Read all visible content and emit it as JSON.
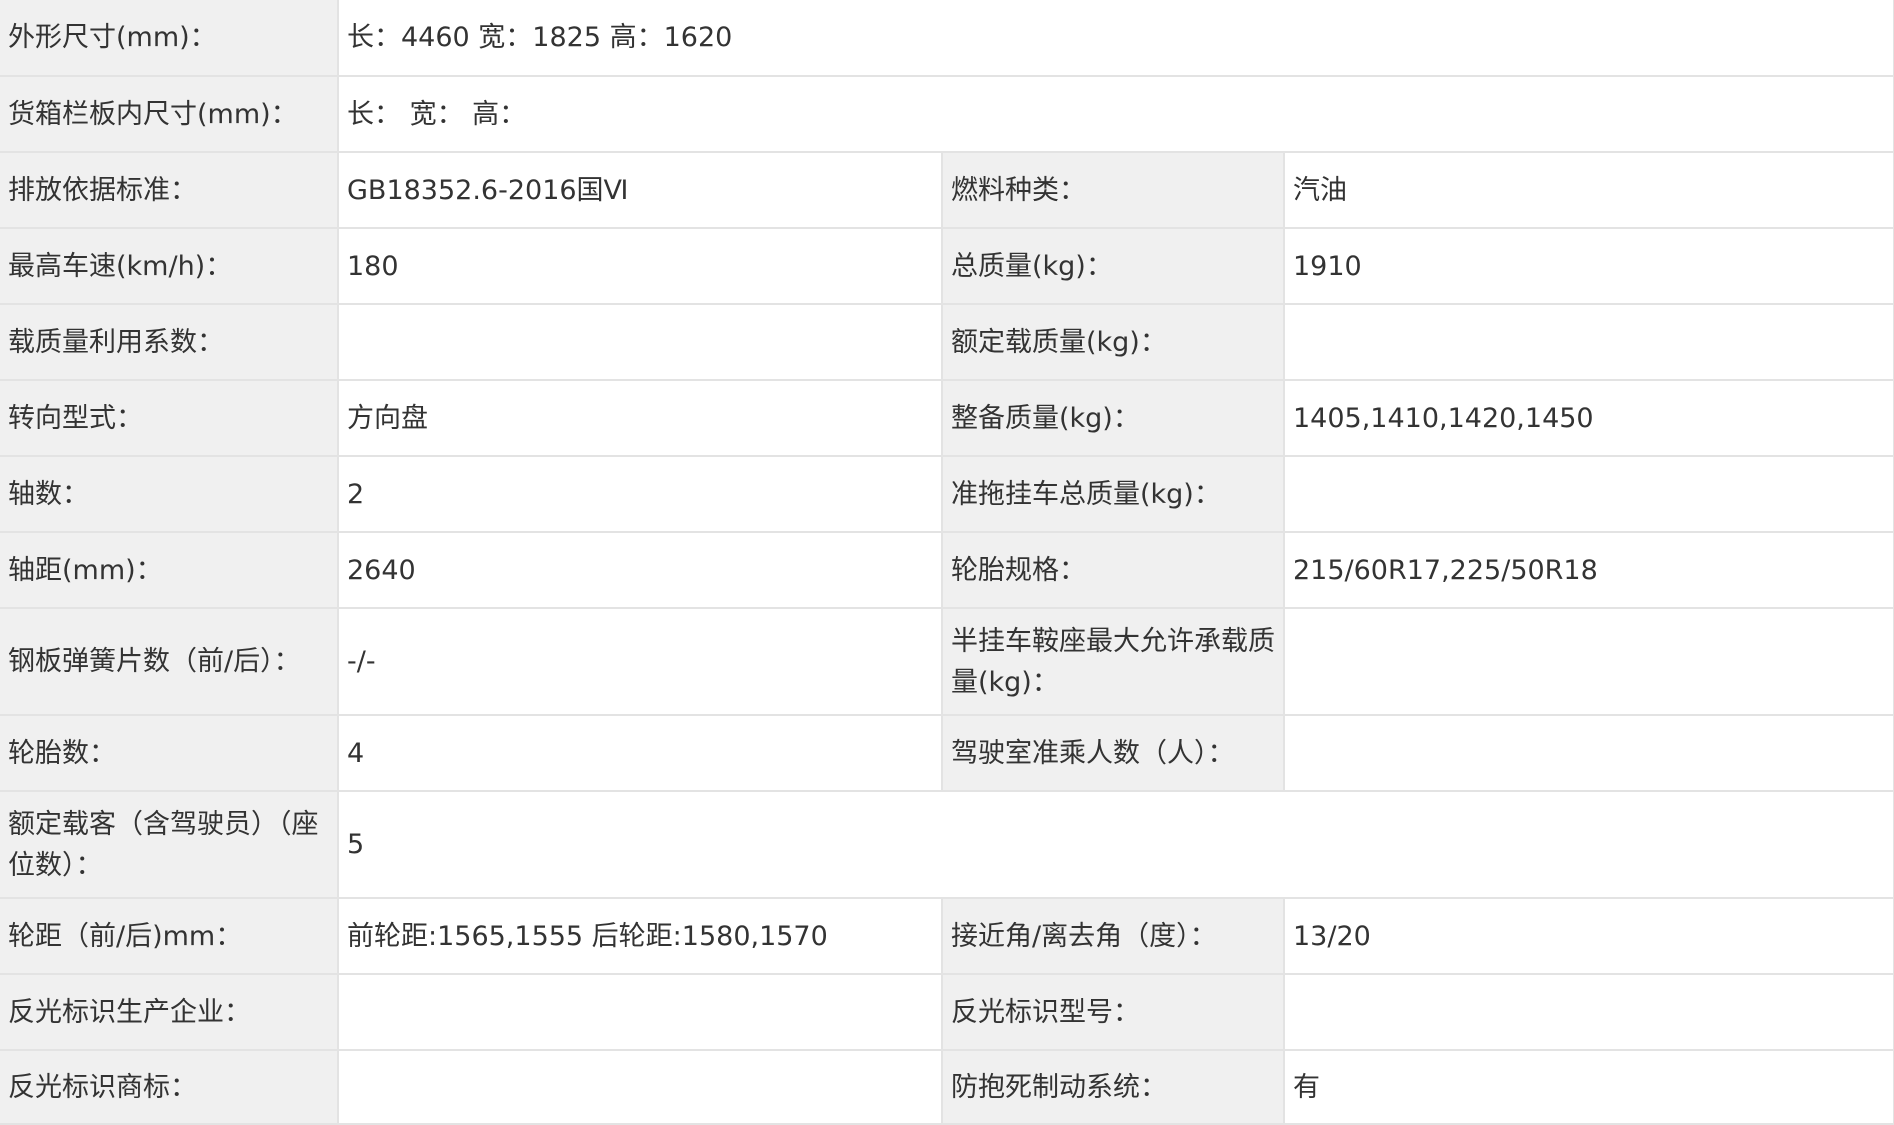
{
  "rows": [
    {
      "l1": "外形尺寸(mm)：",
      "v1": "长：4460 宽：1825 高：1620"
    },
    {
      "l1": "货箱栏板内尺寸(mm)：",
      "v1": "长：  宽：  高："
    },
    {
      "l1": "排放依据标准：",
      "v1": "GB18352.6-2016国Ⅵ",
      "l2": "燃料种类：",
      "v2": "汽油"
    },
    {
      "l1": "最高车速(km/h)：",
      "v1": "180",
      "l2": "总质量(kg)：",
      "v2": "1910"
    },
    {
      "l1": "载质量利用系数：",
      "v1": "",
      "l2": "额定载质量(kg)：",
      "v2": ""
    },
    {
      "l1": "转向型式：",
      "v1": "方向盘",
      "l2": "整备质量(kg)：",
      "v2": "1405,1410,1420,1450"
    },
    {
      "l1": "轴数：",
      "v1": "2",
      "l2": "准拖挂车总质量(kg)：",
      "v2": ""
    },
    {
      "l1": "轴距(mm)：",
      "v1": "2640",
      "l2": "轮胎规格：",
      "v2": "215/60R17,225/50R18"
    },
    {
      "l1": "钢板弹簧片数（前/后）：",
      "v1": "-/-",
      "l2": "半挂车鞍座最大允许承载质量(kg)：",
      "v2": ""
    },
    {
      "l1": "轮胎数：",
      "v1": "4",
      "l2": "驾驶室准乘人数（人）：",
      "v2": ""
    },
    {
      "l1": "额定载客（含驾驶员）（座位数）：",
      "v1": "5"
    },
    {
      "l1": "轮距（前/后)mm：",
      "v1": "前轮距:1565,1555 后轮距:1580,1570",
      "l2": "接近角/离去角（度）：",
      "v2": "13/20"
    },
    {
      "l1": "反光标识生产企业：",
      "v1": "",
      "l2": "反光标识型号：",
      "v2": ""
    },
    {
      "l1": "反光标识商标：",
      "v1": "",
      "l2": "防抱死制动系统：",
      "v2": "有"
    }
  ]
}
